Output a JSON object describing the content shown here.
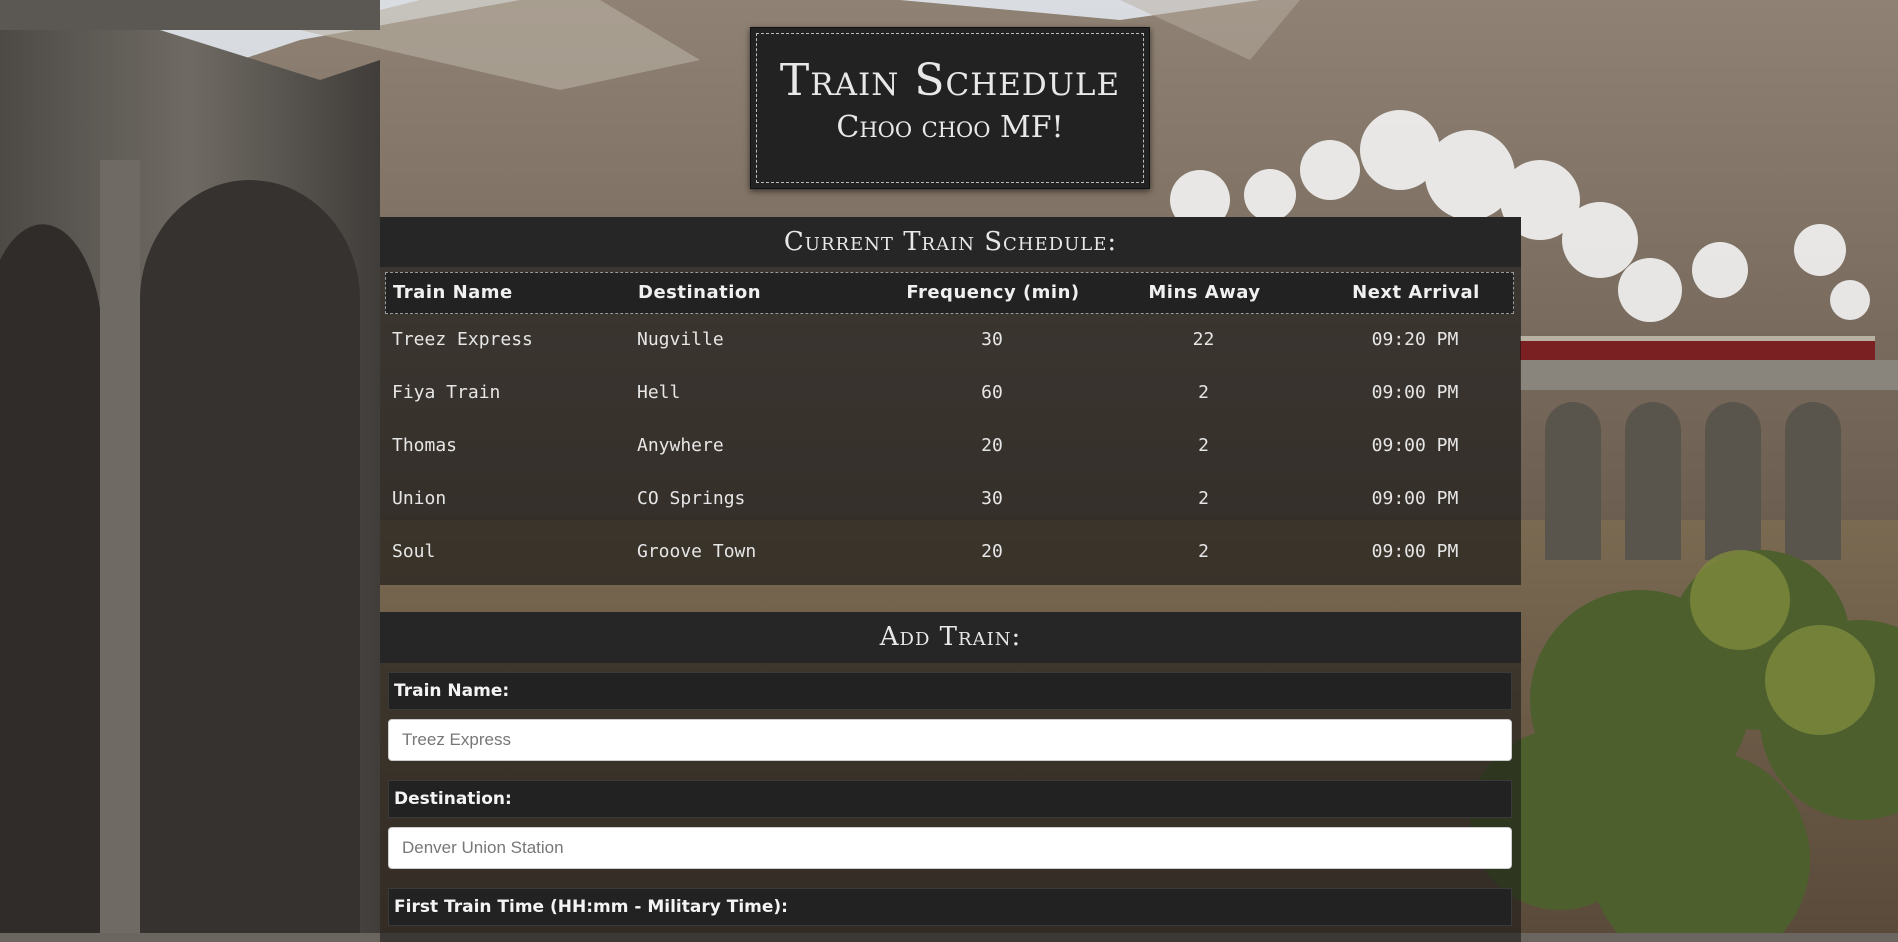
{
  "header": {
    "title": "Train Schedule",
    "subtitle": "Choo choo MF!"
  },
  "schedule": {
    "title": "Current Train Schedule:",
    "columns": [
      "Train Name",
      "Destination",
      "Frequency (min)",
      "Mins Away",
      "Next Arrival"
    ],
    "rows": [
      [
        "Treez Express",
        "Nugville",
        "30",
        "22",
        "09:20 PM"
      ],
      [
        "Fiya Train",
        "Hell",
        "60",
        "2",
        "09:00 PM"
      ],
      [
        "Thomas",
        "Anywhere",
        "20",
        "2",
        "09:00 PM"
      ],
      [
        "Union",
        "CO Springs",
        "30",
        "2",
        "09:00 PM"
      ],
      [
        "Soul",
        "Groove Town",
        "20",
        "2",
        "09:00 PM"
      ]
    ]
  },
  "form": {
    "title": "Add Train:",
    "train_name_label": "Train Name:",
    "train_name_placeholder": "Treez Express",
    "destination_label": "Destination:",
    "destination_placeholder": "Denver Union Station",
    "first_time_label": "First Train Time (HH:mm - Military Time):"
  },
  "colors": {
    "panel_dark": "#222222",
    "text_light": "#e8e8e8"
  }
}
